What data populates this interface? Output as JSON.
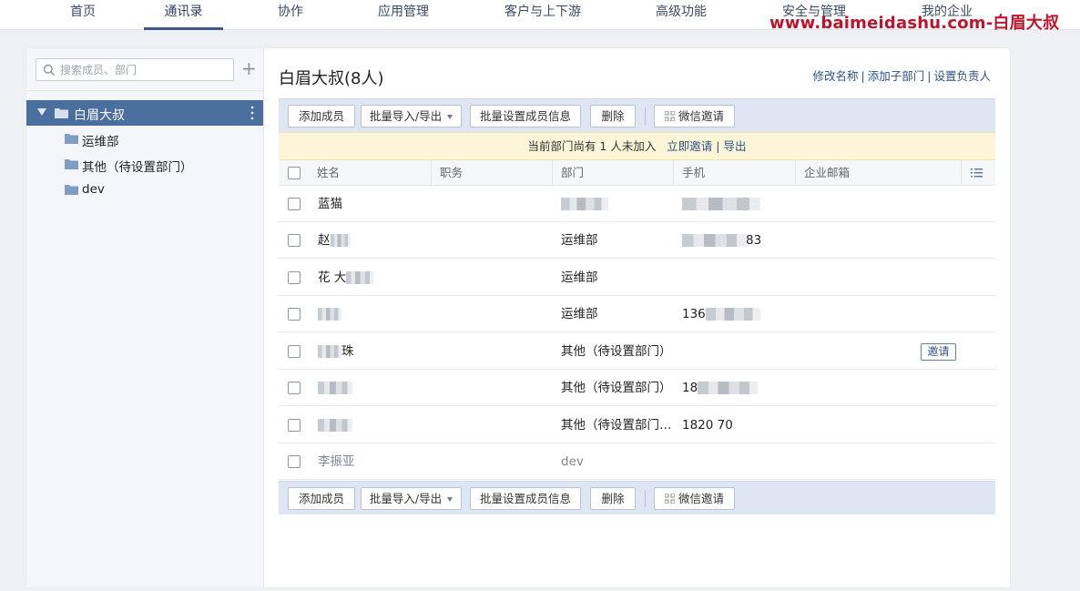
{
  "nav": {
    "tabs": [
      {
        "label": "首页",
        "active": false
      },
      {
        "label": "通讯录",
        "active": true
      },
      {
        "label": "协作",
        "active": false
      },
      {
        "label": "应用管理",
        "active": false
      },
      {
        "label": "客户与上下游",
        "active": false
      },
      {
        "label": "高级功能",
        "active": false
      },
      {
        "label": "安全与管理",
        "active": false
      },
      {
        "label": "我的企业",
        "active": false
      }
    ],
    "watermark": "www.baimeidashu.com-白眉大叔"
  },
  "sidebar": {
    "search_placeholder": "搜索成员、部门",
    "add_symbol": "+",
    "root": {
      "label": "白眉大叔"
    },
    "departments": [
      {
        "label": "运维部"
      },
      {
        "label": "其他（待设置部门）"
      },
      {
        "label": "dev"
      }
    ]
  },
  "main": {
    "title": "白眉大叔(8人)",
    "actions": {
      "rename": "修改名称",
      "add_sub": "添加子部门",
      "set_owner": "设置负责人",
      "sep": "|"
    },
    "toolbar": {
      "add_member": "添加成员",
      "import_export": "批量导入/导出",
      "batch_edit": "批量设置成员信息",
      "delete": "删除",
      "wechat_invite": "微信邀请"
    },
    "notice": {
      "text": "当前部门尚有 1 人未加入",
      "invite_now": "立即邀请",
      "sep": "|",
      "export": "导出"
    },
    "columns": {
      "name": "姓名",
      "title": "职务",
      "dept": "部门",
      "phone": "手机",
      "email": "企业邮箱"
    },
    "rows": [
      {
        "name": "蓝猫",
        "dept": "",
        "phone": ""
      },
      {
        "name": "赵",
        "dept": "运维部",
        "phone": "83"
      },
      {
        "name": "花 大",
        "dept": "运维部",
        "phone": ""
      },
      {
        "name": "",
        "dept": "运维部",
        "phone": "136"
      },
      {
        "name": "珠",
        "dept": "其他（待设置部门）",
        "phone": "",
        "invite": "邀请"
      },
      {
        "name": "",
        "dept": "其他（待设置部门）",
        "phone": "18"
      },
      {
        "name": "",
        "dept": "其他（待设置部门…",
        "phone": "1820   70"
      },
      {
        "name": "李振亚",
        "dept": "dev",
        "phone": "",
        "pending": true
      }
    ]
  }
}
